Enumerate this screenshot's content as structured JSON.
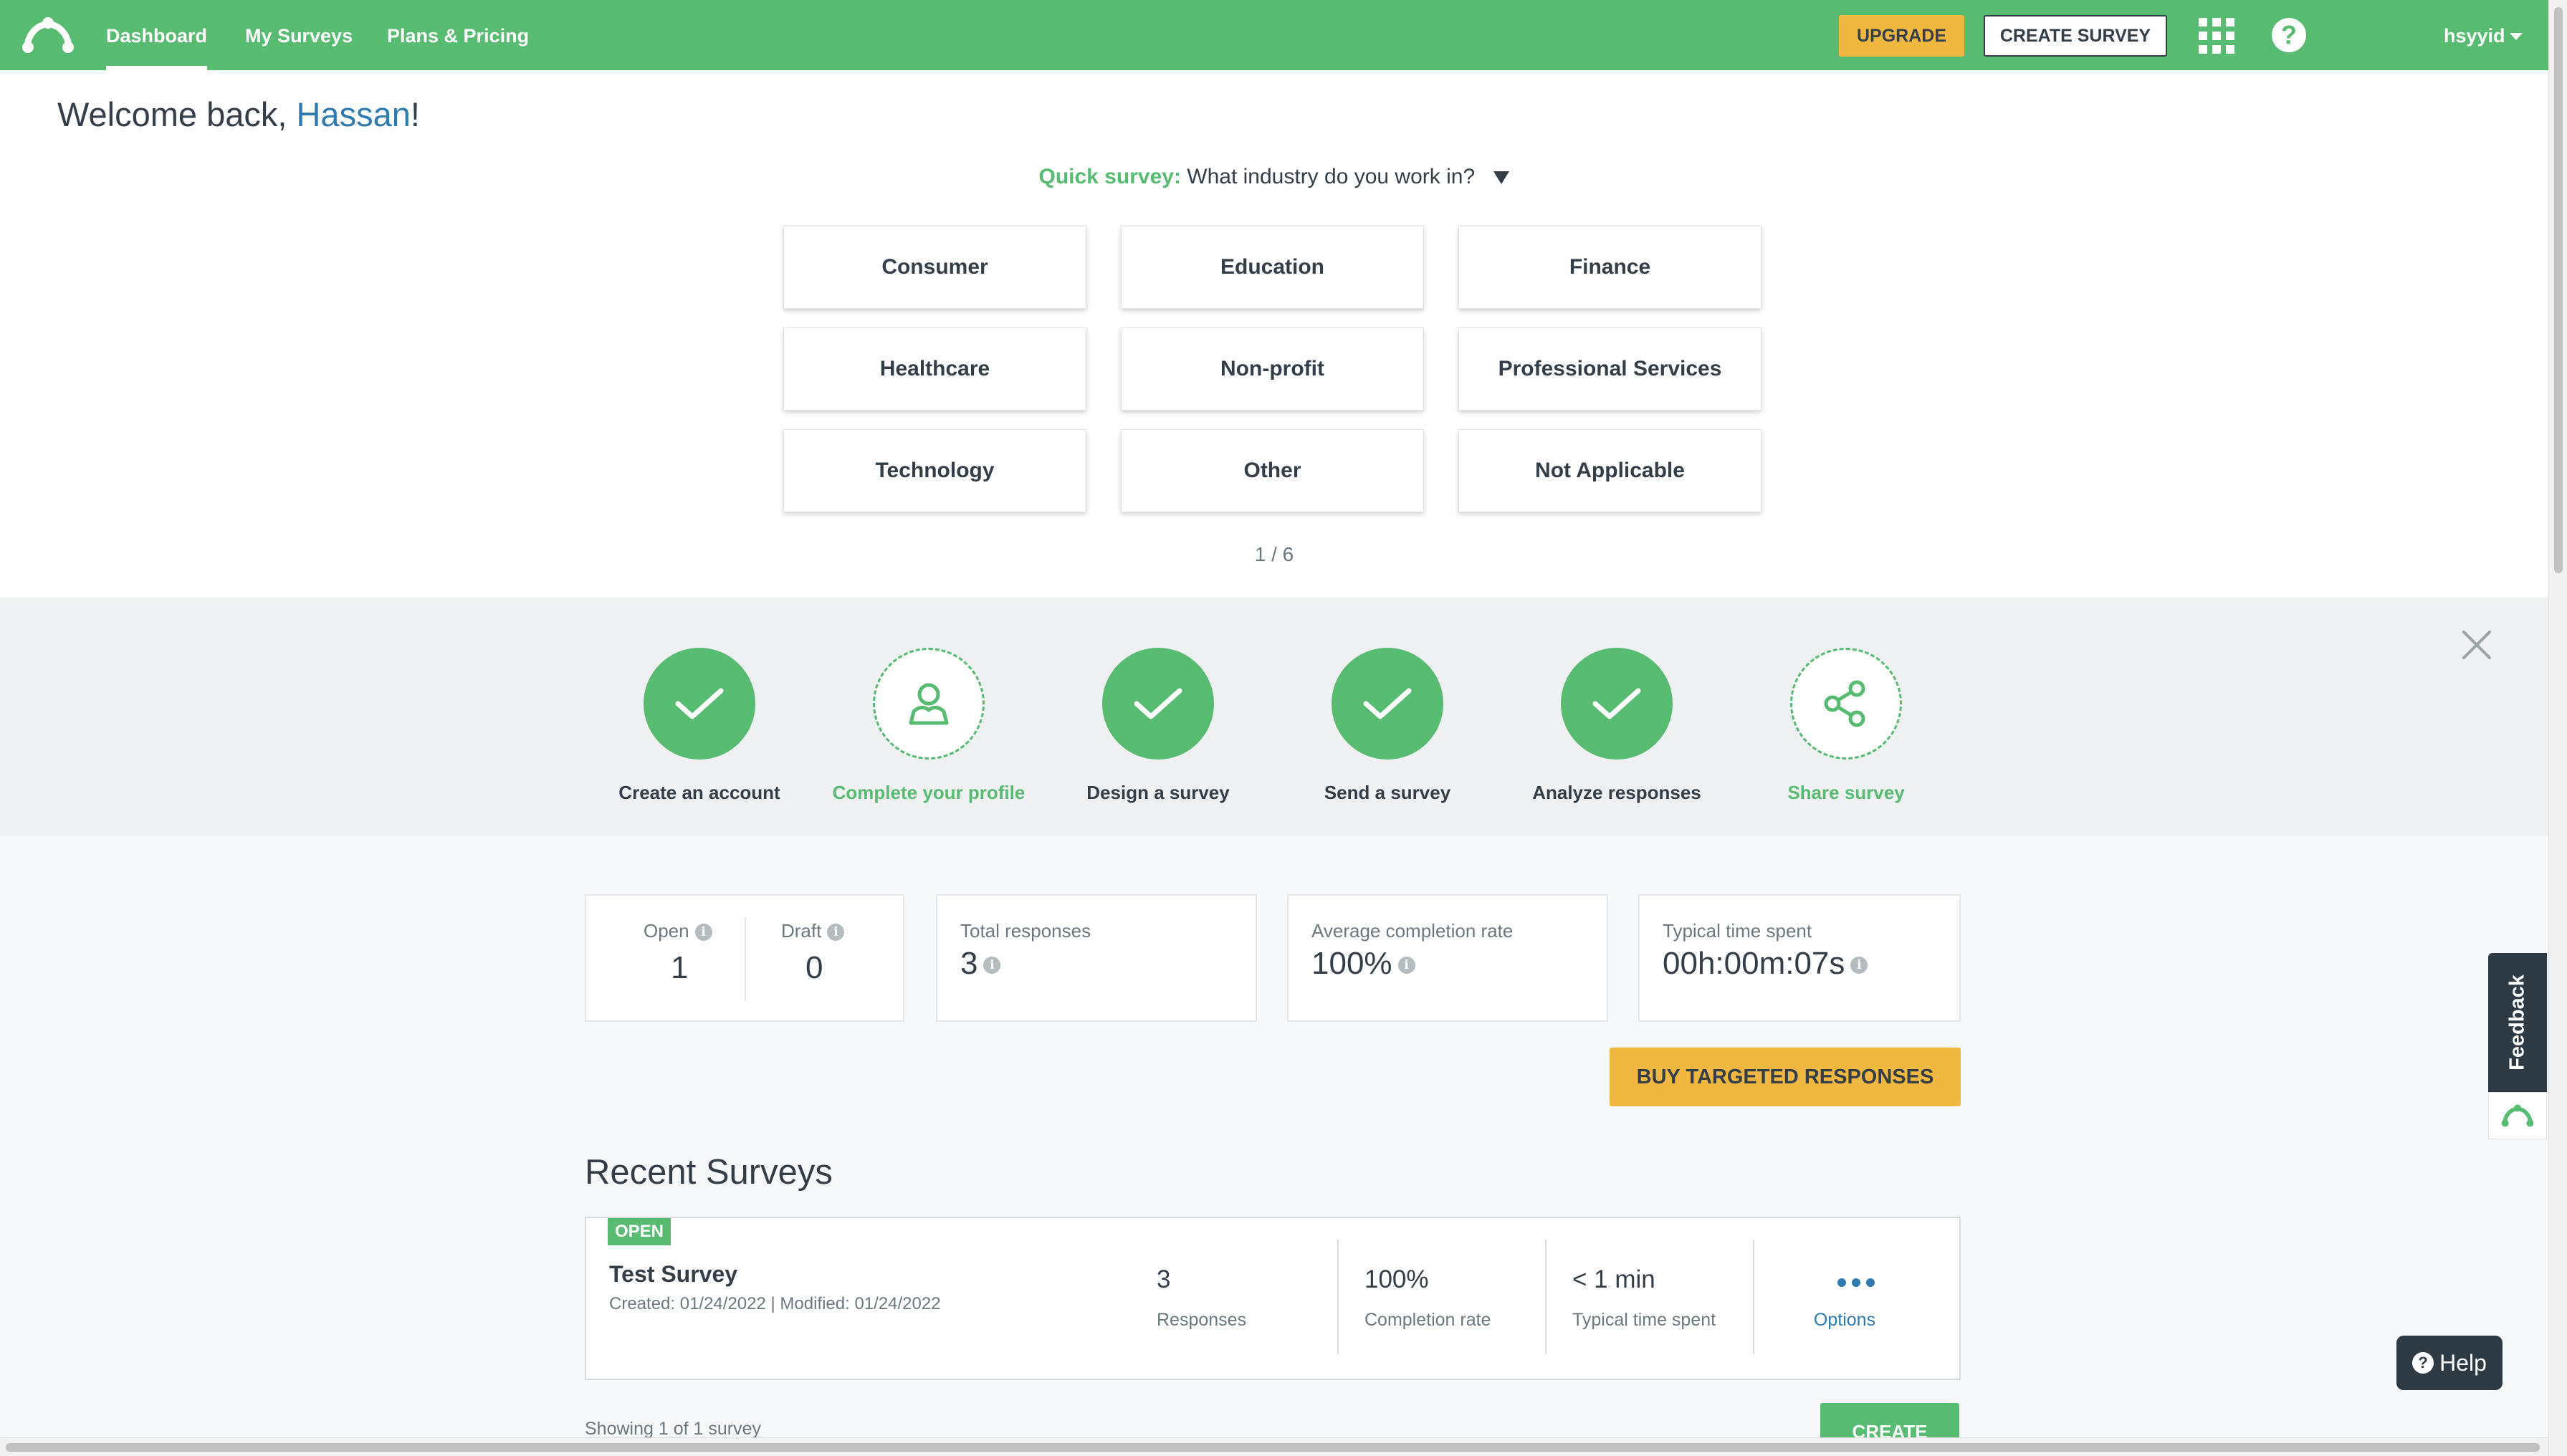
{
  "nav": {
    "links": [
      "Dashboard",
      "My Surveys",
      "Plans & Pricing"
    ],
    "upgrade_label": "UPGRADE",
    "create_survey_label": "CREATE SURVEY",
    "help_glyph": "?",
    "username": "hsyyid"
  },
  "welcome": {
    "prefix": "Welcome back, ",
    "name": "Hassan",
    "suffix": "!"
  },
  "quick_survey": {
    "label": "Quick survey:",
    "question": "What industry do you work in?",
    "options": [
      "Consumer",
      "Education",
      "Finance",
      "Healthcare",
      "Non-profit",
      "Professional Services",
      "Technology",
      "Other",
      "Not Applicable"
    ],
    "pager": "1 / 6"
  },
  "steps": [
    {
      "label": "Create an account",
      "done": true,
      "icon": "check-icon"
    },
    {
      "label": "Complete your profile",
      "done": false,
      "icon": "profile-icon"
    },
    {
      "label": "Design a survey",
      "done": true,
      "icon": "check-icon"
    },
    {
      "label": "Send a survey",
      "done": true,
      "icon": "check-icon"
    },
    {
      "label": "Analyze responses",
      "done": true,
      "icon": "check-icon"
    },
    {
      "label": "Share survey",
      "done": false,
      "icon": "share-icon"
    }
  ],
  "stats": {
    "open_label": "Open",
    "open_value": "1",
    "draft_label": "Draft",
    "draft_value": "0",
    "total_label": "Total responses",
    "total_value": "3",
    "completion_label": "Average completion rate",
    "completion_value": "100%",
    "time_label": "Typical time spent",
    "time_value": "00h:00m:07s",
    "info_glyph": "i"
  },
  "buy_label": "BUY TARGETED RESPONSES",
  "recent": {
    "title": "Recent Surveys",
    "survey": {
      "status": "OPEN",
      "name": "Test Survey",
      "dates": "Created: 01/24/2022   |   Modified: 01/24/2022",
      "responses_value": "3",
      "responses_label": "Responses",
      "completion_value": "100%",
      "completion_label": "Completion rate",
      "time_value": "< 1 min",
      "time_label": "Typical time spent",
      "options_label": "Options"
    },
    "showing": "Showing 1 of 1 survey",
    "create_label": "CREATE"
  },
  "feedback_label": "Feedback",
  "help_label": "Help",
  "colors": {
    "brand_green": "#57bb72",
    "accent_yellow": "#f1b841",
    "link_blue": "#2f7ab0",
    "dark": "#333e48"
  }
}
